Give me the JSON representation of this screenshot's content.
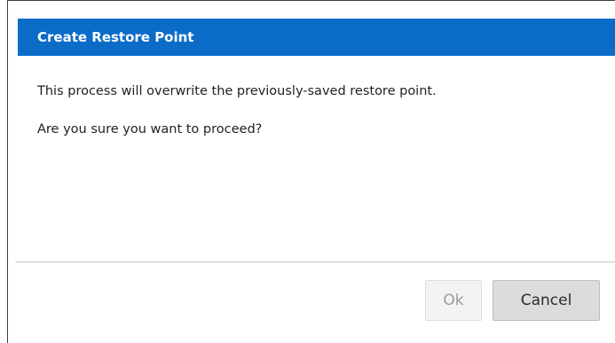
{
  "dialog": {
    "title": "Create Restore Point",
    "message_line1": "This process will overwrite the previously-saved restore point.",
    "message_line2": "Are you sure you want to proceed?",
    "ok_label": "Ok",
    "ok_enabled": false,
    "cancel_label": "Cancel"
  },
  "colors": {
    "titlebar": "#0a6cc7",
    "title_text": "#ffffff",
    "divider": "#c8c8c8",
    "cancel_bg": "#dcdcdc",
    "ok_bg_disabled": "#f3f3f3"
  }
}
